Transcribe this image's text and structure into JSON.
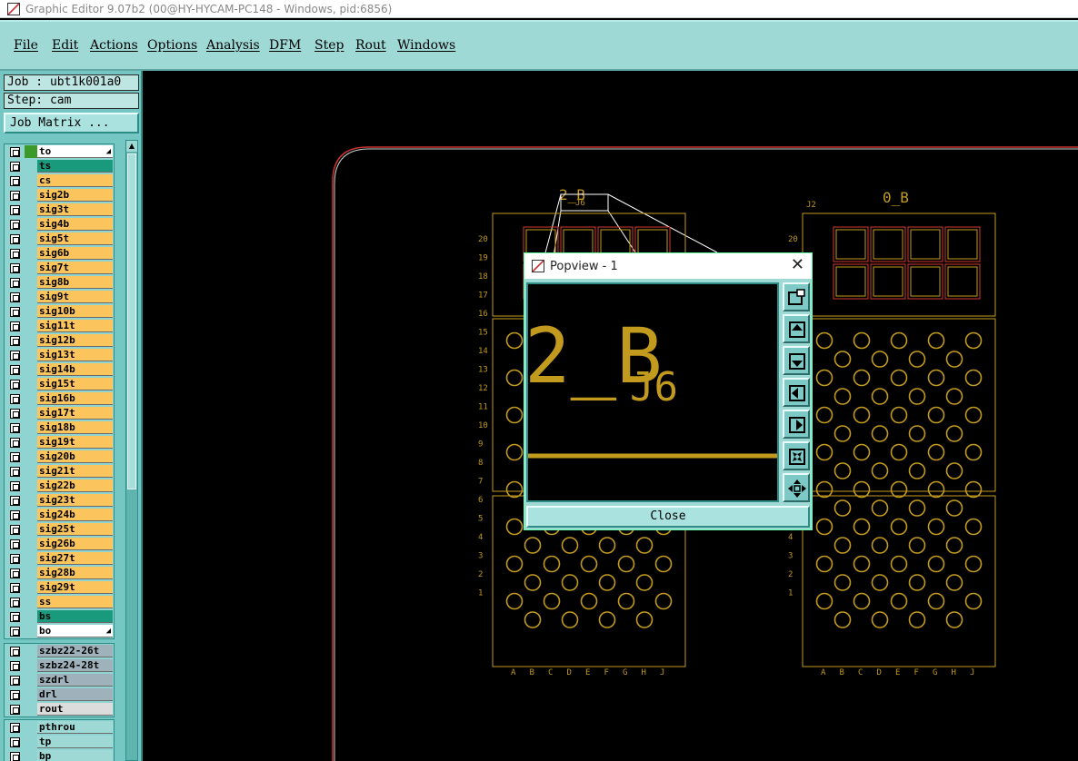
{
  "window": {
    "title": "Graphic Editor 9.07b2 (00@HY-HYCAM-PC148 - Windows, pid:6856)"
  },
  "menu": [
    "File",
    "Edit",
    "Actions",
    "Options",
    "Analysis",
    "DFM",
    "Step",
    "Rout",
    "Windows"
  ],
  "job": {
    "job_line": "Job : ubt1k001a0",
    "step_line": "Step: cam",
    "matrix_button": "Job Matrix ..."
  },
  "layers": [
    {
      "name": "to",
      "bg": "#ffffff",
      "indicator": "#3c9a2a",
      "arrow": true
    },
    {
      "name": "ts",
      "bg": "#1a9a7c"
    },
    {
      "name": "cs",
      "bg": "#fbc45c"
    },
    {
      "name": "sig2b",
      "bg": "#fbc45c"
    },
    {
      "name": "sig3t",
      "bg": "#fbc45c"
    },
    {
      "name": "sig4b",
      "bg": "#fbc45c"
    },
    {
      "name": "sig5t",
      "bg": "#fbc45c"
    },
    {
      "name": "sig6b",
      "bg": "#fbc45c"
    },
    {
      "name": "sig7t",
      "bg": "#fbc45c"
    },
    {
      "name": "sig8b",
      "bg": "#fbc45c"
    },
    {
      "name": "sig9t",
      "bg": "#fbc45c"
    },
    {
      "name": "sig10b",
      "bg": "#fbc45c"
    },
    {
      "name": "sig11t",
      "bg": "#fbc45c"
    },
    {
      "name": "sig12b",
      "bg": "#fbc45c"
    },
    {
      "name": "sig13t",
      "bg": "#fbc45c"
    },
    {
      "name": "sig14b",
      "bg": "#fbc45c"
    },
    {
      "name": "sig15t",
      "bg": "#fbc45c"
    },
    {
      "name": "sig16b",
      "bg": "#fbc45c"
    },
    {
      "name": "sig17t",
      "bg": "#fbc45c"
    },
    {
      "name": "sig18b",
      "bg": "#fbc45c"
    },
    {
      "name": "sig19t",
      "bg": "#fbc45c"
    },
    {
      "name": "sig20b",
      "bg": "#fbc45c"
    },
    {
      "name": "sig21t",
      "bg": "#fbc45c"
    },
    {
      "name": "sig22b",
      "bg": "#fbc45c"
    },
    {
      "name": "sig23t",
      "bg": "#fbc45c"
    },
    {
      "name": "sig24b",
      "bg": "#fbc45c"
    },
    {
      "name": "sig25t",
      "bg": "#fbc45c"
    },
    {
      "name": "sig26b",
      "bg": "#fbc45c"
    },
    {
      "name": "sig27t",
      "bg": "#fbc45c"
    },
    {
      "name": "sig28b",
      "bg": "#fbc45c"
    },
    {
      "name": "sig29t",
      "bg": "#fbc45c"
    },
    {
      "name": "ss",
      "bg": "#fbc45c"
    },
    {
      "name": "bs",
      "bg": "#1a9a7c"
    },
    {
      "name": "bo",
      "bg": "#ffffff",
      "arrow": true
    }
  ],
  "drill_layers": [
    {
      "name": "szbz22-26t",
      "bg": "#9fb2bb"
    },
    {
      "name": "szbz24-28t",
      "bg": "#9fb2bb"
    },
    {
      "name": "szdrl",
      "bg": "#9fb2bb"
    },
    {
      "name": "drl",
      "bg": "#9fb2bb"
    },
    {
      "name": "rout",
      "bg": "#dcdcdc"
    }
  ],
  "misc_layers": [
    {
      "name": "pthrou",
      "bg": "#9ed9d6"
    },
    {
      "name": "tp",
      "bg": "#9ed9d6"
    },
    {
      "name": "bp",
      "bg": "#9ed9d6"
    }
  ],
  "board": {
    "left_label": "2_B",
    "left_sub": "J6",
    "right_label": "0_B",
    "right_sub": "J2",
    "row_labels": [
      "20",
      "19",
      "18",
      "17",
      "16",
      "15",
      "14",
      "13",
      "12",
      "11",
      "10",
      "9",
      "8",
      "7",
      "6",
      "5",
      "4",
      "3",
      "2",
      "1"
    ],
    "col_labels": [
      "A",
      "B",
      "C",
      "D",
      "E",
      "F",
      "G",
      "H",
      "J"
    ]
  },
  "popview": {
    "title": "Popview - 1",
    "close_label": "Close",
    "zoom_label": "2_B",
    "zoom_sub": "J6"
  },
  "colors": {
    "trace": "#c29a1e",
    "outline": "#c8d8d0",
    "board_edge": "#cc3333"
  }
}
